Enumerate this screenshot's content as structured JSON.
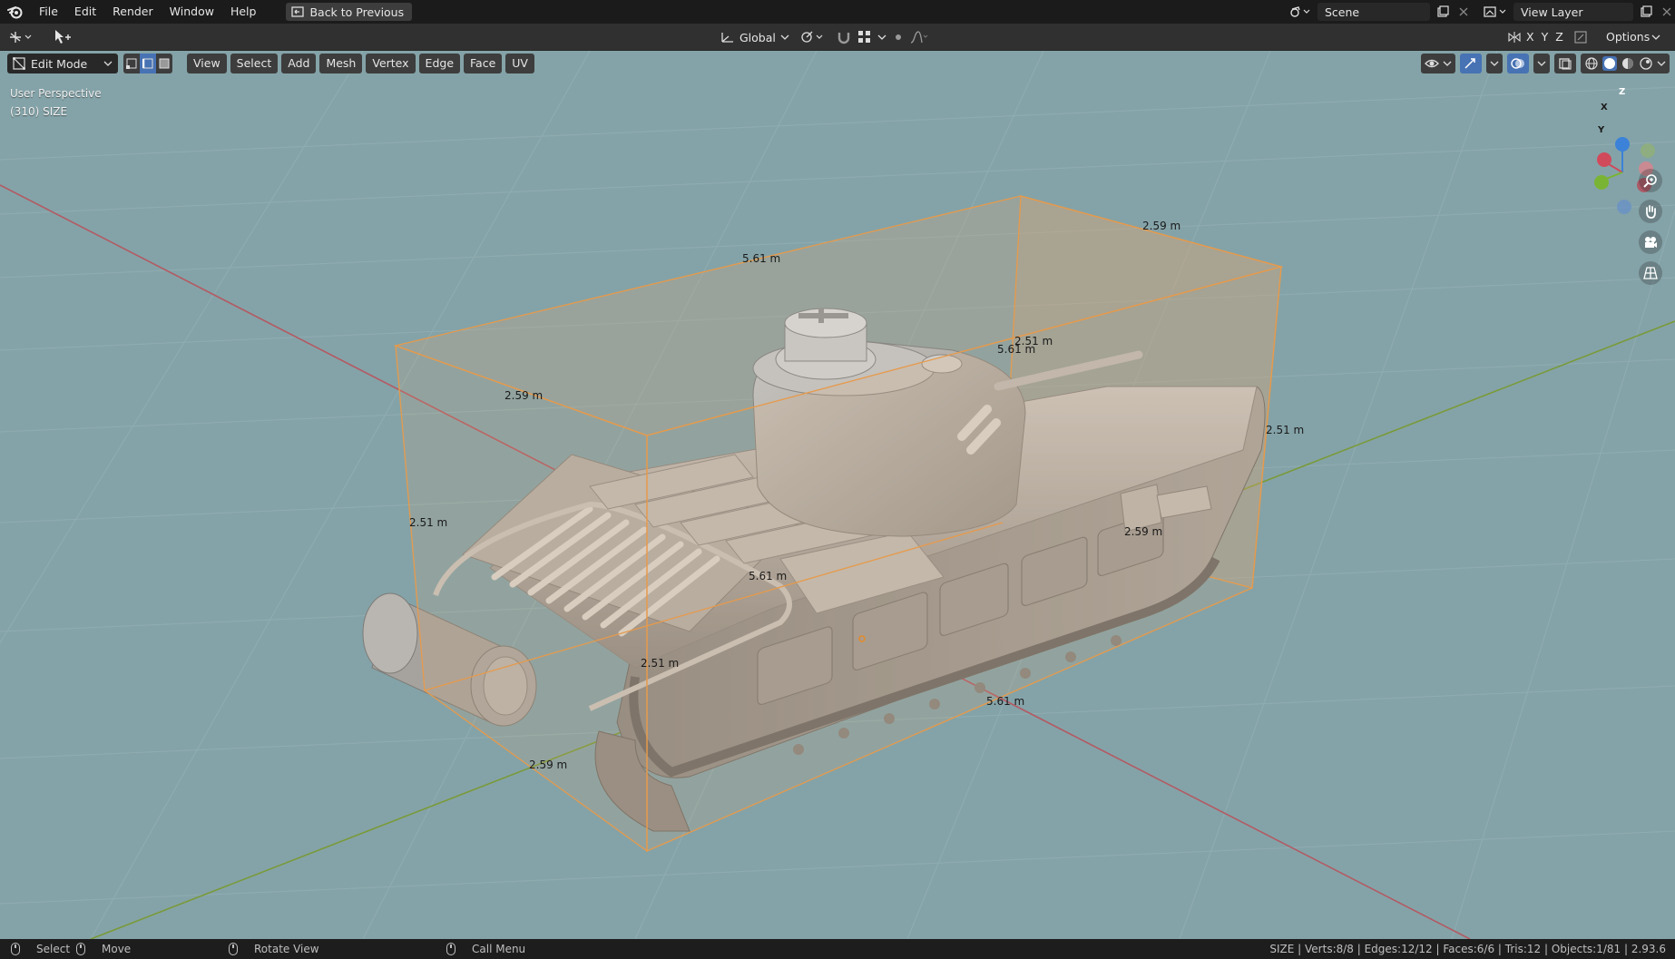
{
  "menubar": {
    "items": [
      "File",
      "Edit",
      "Render",
      "Window",
      "Help"
    ],
    "back_button": "Back to Previous",
    "scene_label": "Scene",
    "view_layer_label": "View Layer"
  },
  "tool_header": {
    "transform_orientation": "Global",
    "axes": [
      "X",
      "Y",
      "Z"
    ],
    "options_label": "Options"
  },
  "editor_header": {
    "mode": "Edit Mode",
    "menus": [
      "View",
      "Select",
      "Add",
      "Mesh",
      "Vertex",
      "Edge",
      "Face",
      "UV"
    ]
  },
  "viewport": {
    "perspective_label": "User Perspective",
    "object_label": "(310) SIZE",
    "dimension_labels": [
      "5.61 m",
      "2.59 m",
      "2.59 m",
      "2.51 m",
      "5.61 m",
      "2.51 m",
      "2.51 m",
      "2.59 m",
      "5.61 m",
      "2.51 m",
      "5.61 m",
      "2.59 m"
    ],
    "gizmo_axes": [
      "Z",
      "X",
      "Y"
    ]
  },
  "statusbar": {
    "select": "Select",
    "move": "Move",
    "rotate": "Rotate View",
    "call_menu": "Call Menu",
    "stats": "SIZE | Verts:8/8 | Edges:12/12 | Faces:6/6 | Tris:12 | Objects:1/81 | 2.93.6"
  },
  "colors": {
    "viewport_bg": "#84a3a8",
    "grid": "#93b0b4",
    "x_axis": "#b35a63",
    "y_axis": "#7a9a3a",
    "bbox_edge": "#e79a4b",
    "bbox_fill": "#e2a66e",
    "selection_blue": "#4772b3"
  }
}
